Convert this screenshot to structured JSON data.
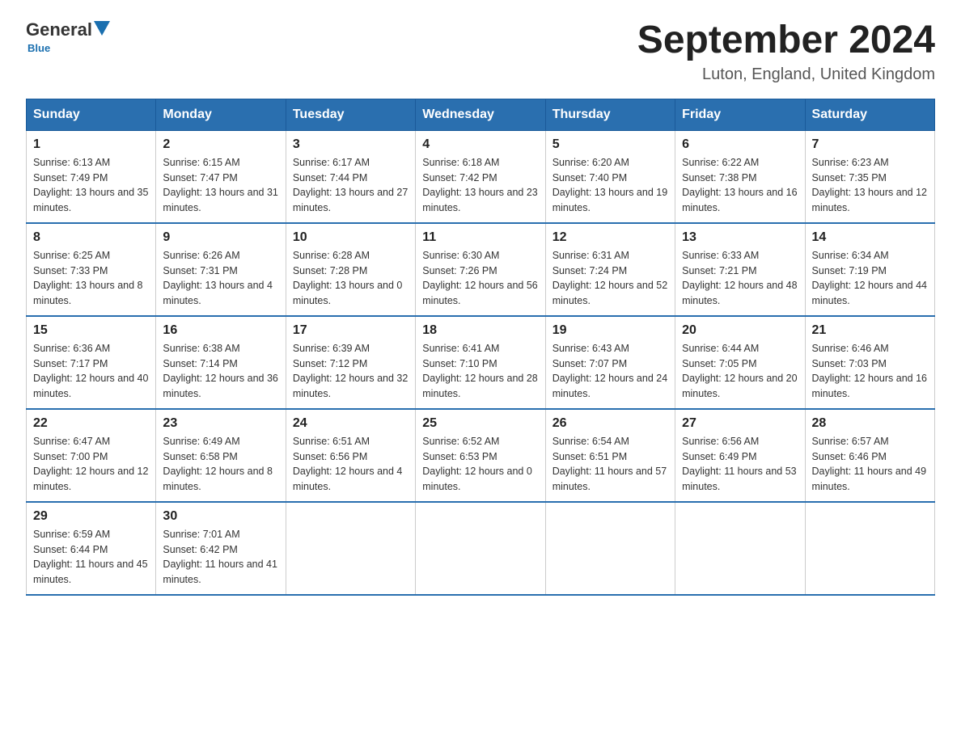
{
  "logo": {
    "general": "General",
    "blue": "Blue",
    "tagline": "Blue"
  },
  "title": "September 2024",
  "subtitle": "Luton, England, United Kingdom",
  "days_header": [
    "Sunday",
    "Monday",
    "Tuesday",
    "Wednesday",
    "Thursday",
    "Friday",
    "Saturday"
  ],
  "weeks": [
    [
      {
        "day": "1",
        "sunrise": "Sunrise: 6:13 AM",
        "sunset": "Sunset: 7:49 PM",
        "daylight": "Daylight: 13 hours and 35 minutes."
      },
      {
        "day": "2",
        "sunrise": "Sunrise: 6:15 AM",
        "sunset": "Sunset: 7:47 PM",
        "daylight": "Daylight: 13 hours and 31 minutes."
      },
      {
        "day": "3",
        "sunrise": "Sunrise: 6:17 AM",
        "sunset": "Sunset: 7:44 PM",
        "daylight": "Daylight: 13 hours and 27 minutes."
      },
      {
        "day": "4",
        "sunrise": "Sunrise: 6:18 AM",
        "sunset": "Sunset: 7:42 PM",
        "daylight": "Daylight: 13 hours and 23 minutes."
      },
      {
        "day": "5",
        "sunrise": "Sunrise: 6:20 AM",
        "sunset": "Sunset: 7:40 PM",
        "daylight": "Daylight: 13 hours and 19 minutes."
      },
      {
        "day": "6",
        "sunrise": "Sunrise: 6:22 AM",
        "sunset": "Sunset: 7:38 PM",
        "daylight": "Daylight: 13 hours and 16 minutes."
      },
      {
        "day": "7",
        "sunrise": "Sunrise: 6:23 AM",
        "sunset": "Sunset: 7:35 PM",
        "daylight": "Daylight: 13 hours and 12 minutes."
      }
    ],
    [
      {
        "day": "8",
        "sunrise": "Sunrise: 6:25 AM",
        "sunset": "Sunset: 7:33 PM",
        "daylight": "Daylight: 13 hours and 8 minutes."
      },
      {
        "day": "9",
        "sunrise": "Sunrise: 6:26 AM",
        "sunset": "Sunset: 7:31 PM",
        "daylight": "Daylight: 13 hours and 4 minutes."
      },
      {
        "day": "10",
        "sunrise": "Sunrise: 6:28 AM",
        "sunset": "Sunset: 7:28 PM",
        "daylight": "Daylight: 13 hours and 0 minutes."
      },
      {
        "day": "11",
        "sunrise": "Sunrise: 6:30 AM",
        "sunset": "Sunset: 7:26 PM",
        "daylight": "Daylight: 12 hours and 56 minutes."
      },
      {
        "day": "12",
        "sunrise": "Sunrise: 6:31 AM",
        "sunset": "Sunset: 7:24 PM",
        "daylight": "Daylight: 12 hours and 52 minutes."
      },
      {
        "day": "13",
        "sunrise": "Sunrise: 6:33 AM",
        "sunset": "Sunset: 7:21 PM",
        "daylight": "Daylight: 12 hours and 48 minutes."
      },
      {
        "day": "14",
        "sunrise": "Sunrise: 6:34 AM",
        "sunset": "Sunset: 7:19 PM",
        "daylight": "Daylight: 12 hours and 44 minutes."
      }
    ],
    [
      {
        "day": "15",
        "sunrise": "Sunrise: 6:36 AM",
        "sunset": "Sunset: 7:17 PM",
        "daylight": "Daylight: 12 hours and 40 minutes."
      },
      {
        "day": "16",
        "sunrise": "Sunrise: 6:38 AM",
        "sunset": "Sunset: 7:14 PM",
        "daylight": "Daylight: 12 hours and 36 minutes."
      },
      {
        "day": "17",
        "sunrise": "Sunrise: 6:39 AM",
        "sunset": "Sunset: 7:12 PM",
        "daylight": "Daylight: 12 hours and 32 minutes."
      },
      {
        "day": "18",
        "sunrise": "Sunrise: 6:41 AM",
        "sunset": "Sunset: 7:10 PM",
        "daylight": "Daylight: 12 hours and 28 minutes."
      },
      {
        "day": "19",
        "sunrise": "Sunrise: 6:43 AM",
        "sunset": "Sunset: 7:07 PM",
        "daylight": "Daylight: 12 hours and 24 minutes."
      },
      {
        "day": "20",
        "sunrise": "Sunrise: 6:44 AM",
        "sunset": "Sunset: 7:05 PM",
        "daylight": "Daylight: 12 hours and 20 minutes."
      },
      {
        "day": "21",
        "sunrise": "Sunrise: 6:46 AM",
        "sunset": "Sunset: 7:03 PM",
        "daylight": "Daylight: 12 hours and 16 minutes."
      }
    ],
    [
      {
        "day": "22",
        "sunrise": "Sunrise: 6:47 AM",
        "sunset": "Sunset: 7:00 PM",
        "daylight": "Daylight: 12 hours and 12 minutes."
      },
      {
        "day": "23",
        "sunrise": "Sunrise: 6:49 AM",
        "sunset": "Sunset: 6:58 PM",
        "daylight": "Daylight: 12 hours and 8 minutes."
      },
      {
        "day": "24",
        "sunrise": "Sunrise: 6:51 AM",
        "sunset": "Sunset: 6:56 PM",
        "daylight": "Daylight: 12 hours and 4 minutes."
      },
      {
        "day": "25",
        "sunrise": "Sunrise: 6:52 AM",
        "sunset": "Sunset: 6:53 PM",
        "daylight": "Daylight: 12 hours and 0 minutes."
      },
      {
        "day": "26",
        "sunrise": "Sunrise: 6:54 AM",
        "sunset": "Sunset: 6:51 PM",
        "daylight": "Daylight: 11 hours and 57 minutes."
      },
      {
        "day": "27",
        "sunrise": "Sunrise: 6:56 AM",
        "sunset": "Sunset: 6:49 PM",
        "daylight": "Daylight: 11 hours and 53 minutes."
      },
      {
        "day": "28",
        "sunrise": "Sunrise: 6:57 AM",
        "sunset": "Sunset: 6:46 PM",
        "daylight": "Daylight: 11 hours and 49 minutes."
      }
    ],
    [
      {
        "day": "29",
        "sunrise": "Sunrise: 6:59 AM",
        "sunset": "Sunset: 6:44 PM",
        "daylight": "Daylight: 11 hours and 45 minutes."
      },
      {
        "day": "30",
        "sunrise": "Sunrise: 7:01 AM",
        "sunset": "Sunset: 6:42 PM",
        "daylight": "Daylight: 11 hours and 41 minutes."
      },
      null,
      null,
      null,
      null,
      null
    ]
  ]
}
